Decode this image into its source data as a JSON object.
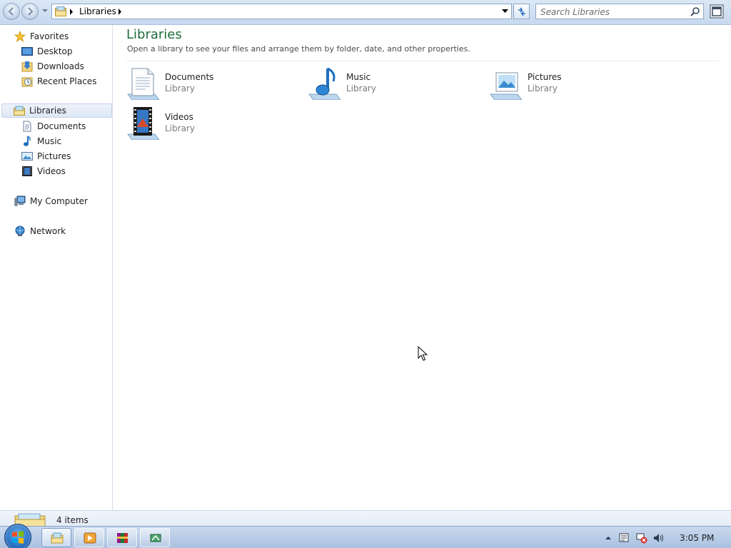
{
  "address_bar": {
    "breadcrumb": "Libraries"
  },
  "search": {
    "placeholder": "Search Libraries"
  },
  "sidebar": {
    "favorites": {
      "header": "Favorites",
      "items": [
        {
          "label": "Desktop",
          "icon": "desktop-icon"
        },
        {
          "label": "Downloads",
          "icon": "downloads-icon"
        },
        {
          "label": "Recent Places",
          "icon": "recent-places-icon"
        }
      ]
    },
    "libraries": {
      "header": "Libraries",
      "items": [
        {
          "label": "Documents",
          "icon": "documents-icon"
        },
        {
          "label": "Music",
          "icon": "music-icon"
        },
        {
          "label": "Pictures",
          "icon": "pictures-icon"
        },
        {
          "label": "Videos",
          "icon": "videos-icon"
        }
      ]
    },
    "computer": {
      "label": "My Computer",
      "icon": "computer-icon"
    },
    "network": {
      "label": "Network",
      "icon": "network-icon"
    }
  },
  "main": {
    "title": "Libraries",
    "subtitle": "Open a library to see your files and arrange them by folder, date, and other properties.",
    "libraries": [
      {
        "name": "Documents",
        "type": "Library",
        "icon": "documents-library-icon"
      },
      {
        "name": "Music",
        "type": "Library",
        "icon": "music-library-icon"
      },
      {
        "name": "Pictures",
        "type": "Library",
        "icon": "pictures-library-icon"
      },
      {
        "name": "Videos",
        "type": "Library",
        "icon": "videos-library-icon"
      }
    ]
  },
  "status": {
    "item_count": "4 items"
  },
  "taskbar": {
    "clock": "3:05 PM",
    "pinned": [
      "file-explorer-icon",
      "media-player-icon",
      "winrar-icon",
      "network-app-icon"
    ],
    "tray": [
      "show-hidden-icons-arrow",
      "action-center-icon",
      "network-disconnected-icon",
      "volume-icon"
    ]
  },
  "colors": {
    "title_green": "#1e6c3a",
    "taskbar_blue": "#a9c1df",
    "selection_blue": "#dde7f4"
  }
}
